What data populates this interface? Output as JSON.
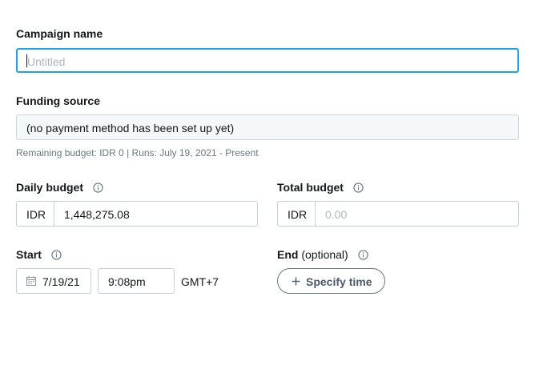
{
  "campaign_name": {
    "label": "Campaign name",
    "placeholder": "Untitled",
    "value": ""
  },
  "funding_source": {
    "label": "Funding source",
    "value": "(no payment method has been set up yet)",
    "help": "Remaining budget: IDR 0 | Runs: July 19, 2021 - Present"
  },
  "daily_budget": {
    "label": "Daily budget",
    "currency": "IDR",
    "value": "1,448,275.08"
  },
  "total_budget": {
    "label": "Total budget",
    "currency": "IDR",
    "placeholder": "0.00"
  },
  "start": {
    "label": "Start",
    "date": "7/19/21",
    "time": "9:08pm",
    "timezone": "GMT+7"
  },
  "end": {
    "label": "End",
    "optional": "(optional)",
    "button_label": "Specify time"
  },
  "icons": {
    "info": "info-circle-icon",
    "calendar": "calendar-icon",
    "plus": "plus-icon"
  },
  "colors": {
    "focus_border": "#1da1f2",
    "border": "#c4cfd6",
    "disabled_bg": "#f5f8fa",
    "muted_text": "#657786"
  }
}
